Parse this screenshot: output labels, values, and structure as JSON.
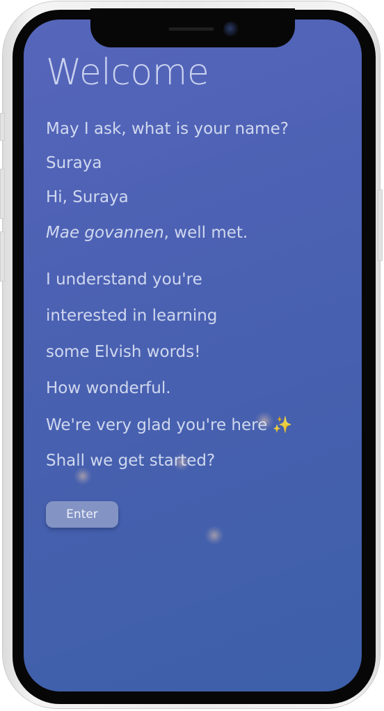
{
  "title": "Welcome",
  "conversation": {
    "question": "May I ask, what is your name?",
    "answer": "Suraya",
    "greeting": "Hi, Suraya",
    "elvish_phrase": "Mae govannen",
    "elvish_suffix": ", well met.",
    "body_lines": [
      "I understand you're",
      "interested in learning",
      "some Elvish words!",
      "How wonderful.",
      "We're very glad you're here ✨",
      "Shall we get started?"
    ]
  },
  "enter_button_label": "Enter"
}
